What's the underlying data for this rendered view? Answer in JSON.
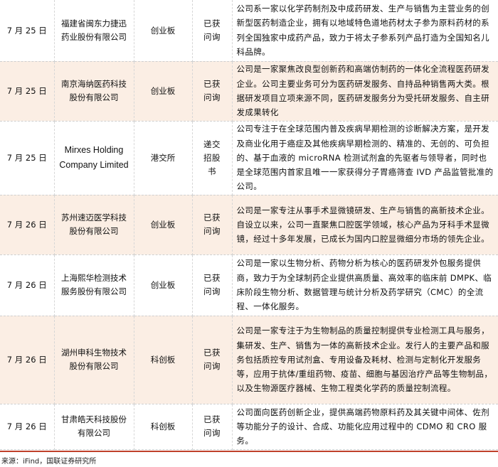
{
  "rows": [
    {
      "date": "7 月 25 日",
      "company": "福建省闽东力捷迅药业股份有限公司",
      "board": "创业板",
      "status": "已获问询",
      "description": "公司系一家以化学药制剂及中成药研发、生产与销售为主营业务的创新型医药制造企业，拥有以地域特色道地药材太子参为原料药材的系列全国独家中成药产品，致力于将太子参系列产品打造为全国知名儿科品牌。"
    },
    {
      "date": "7 月 25 日",
      "company": "南京海纳医药科技股份有限公司",
      "board": "创业板",
      "status": "已获问询",
      "description": "公司是一家聚焦改良型创新药和高端仿制药的一体化全流程医药研发企业。公司主要业务可分为医药研发服务、自持品种销售两大类。根据研发项目立项来源不同，医药研发服务分为受托研发服务、自主研发成果转化"
    },
    {
      "date": "7 月 25 日",
      "company": "Mirxes Holding Company Limited",
      "board": "港交所",
      "status": "递交招股书",
      "description": "公司专注于在全球范围内普及疾病早期检测的诊断解决方案，是开发及商业化用于癌症及其他疾病早期检测的、精准的、无创的、可负担的、基于血液的 microRNA 检测试剂盒的先驱者与领导者，同时也是全球范围内首家且唯一一家获得分子胃癌筛查 IVD 产品监管批准的公司。"
    },
    {
      "date": "7 月 26 日",
      "company": "苏州速迈医学科技股份有限公司",
      "board": "创业板",
      "status": "已获问询",
      "description": "公司是一家专注从事手术显微镜研发、生产与销售的高新技术企业。自设立以来，公司一直聚焦口腔医学领域，核心产品为牙科手术显微镜，经过十多年发展，已成长为国内口腔显微细分市场的领先企业。"
    },
    {
      "date": "7 月 26 日",
      "company": "上海熙华检测技术服务股份有限公司",
      "board": "创业板",
      "status": "已获问询",
      "description": "公司是一家以生物分析、药物分析为核心的医药研发外包服务提供商，致力于为全球制药企业提供高质量、高效率的临床前 DMPK、临床阶段生物分析、数据管理与统计分析及药学研究（CMC）的全流程、一体化服务。"
    },
    {
      "date": "7 月 26 日",
      "company": "湖州申科生物技术股份有限公司",
      "board": "科创板",
      "status": "已获问询",
      "description": "公司是一家专注于为生物制品的质量控制提供专业检测工具与服务，集研发、生产、销售为一体的高新技术企业。发行人的主要产品和服务包括质控专用试剂盒、专用设备及耗材、检测与定制化开发服务等，应用于抗体/重组药物、疫苗、细胞与基因治疗产品等生物制品，以及生物源医疗器械、生物工程类化学药的质量控制流程。"
    },
    {
      "date": "7 月 26 日",
      "company": "甘肃皓天科技股份有限公司",
      "board": "科创板",
      "status": "已获问询",
      "description": "公司面向医药创新企业，提供高端药物原料药及其关键中间体、佐剂等功能分子的设计、合成、功能化应用过程中的 CDMO 和 CRO 服务。"
    }
  ],
  "source": "来源：iFind，国联证券研究所",
  "colors": {
    "accent_bar": "#c0412b",
    "shaded_row": "#fbeee4",
    "divider": "#cfcfcf"
  }
}
